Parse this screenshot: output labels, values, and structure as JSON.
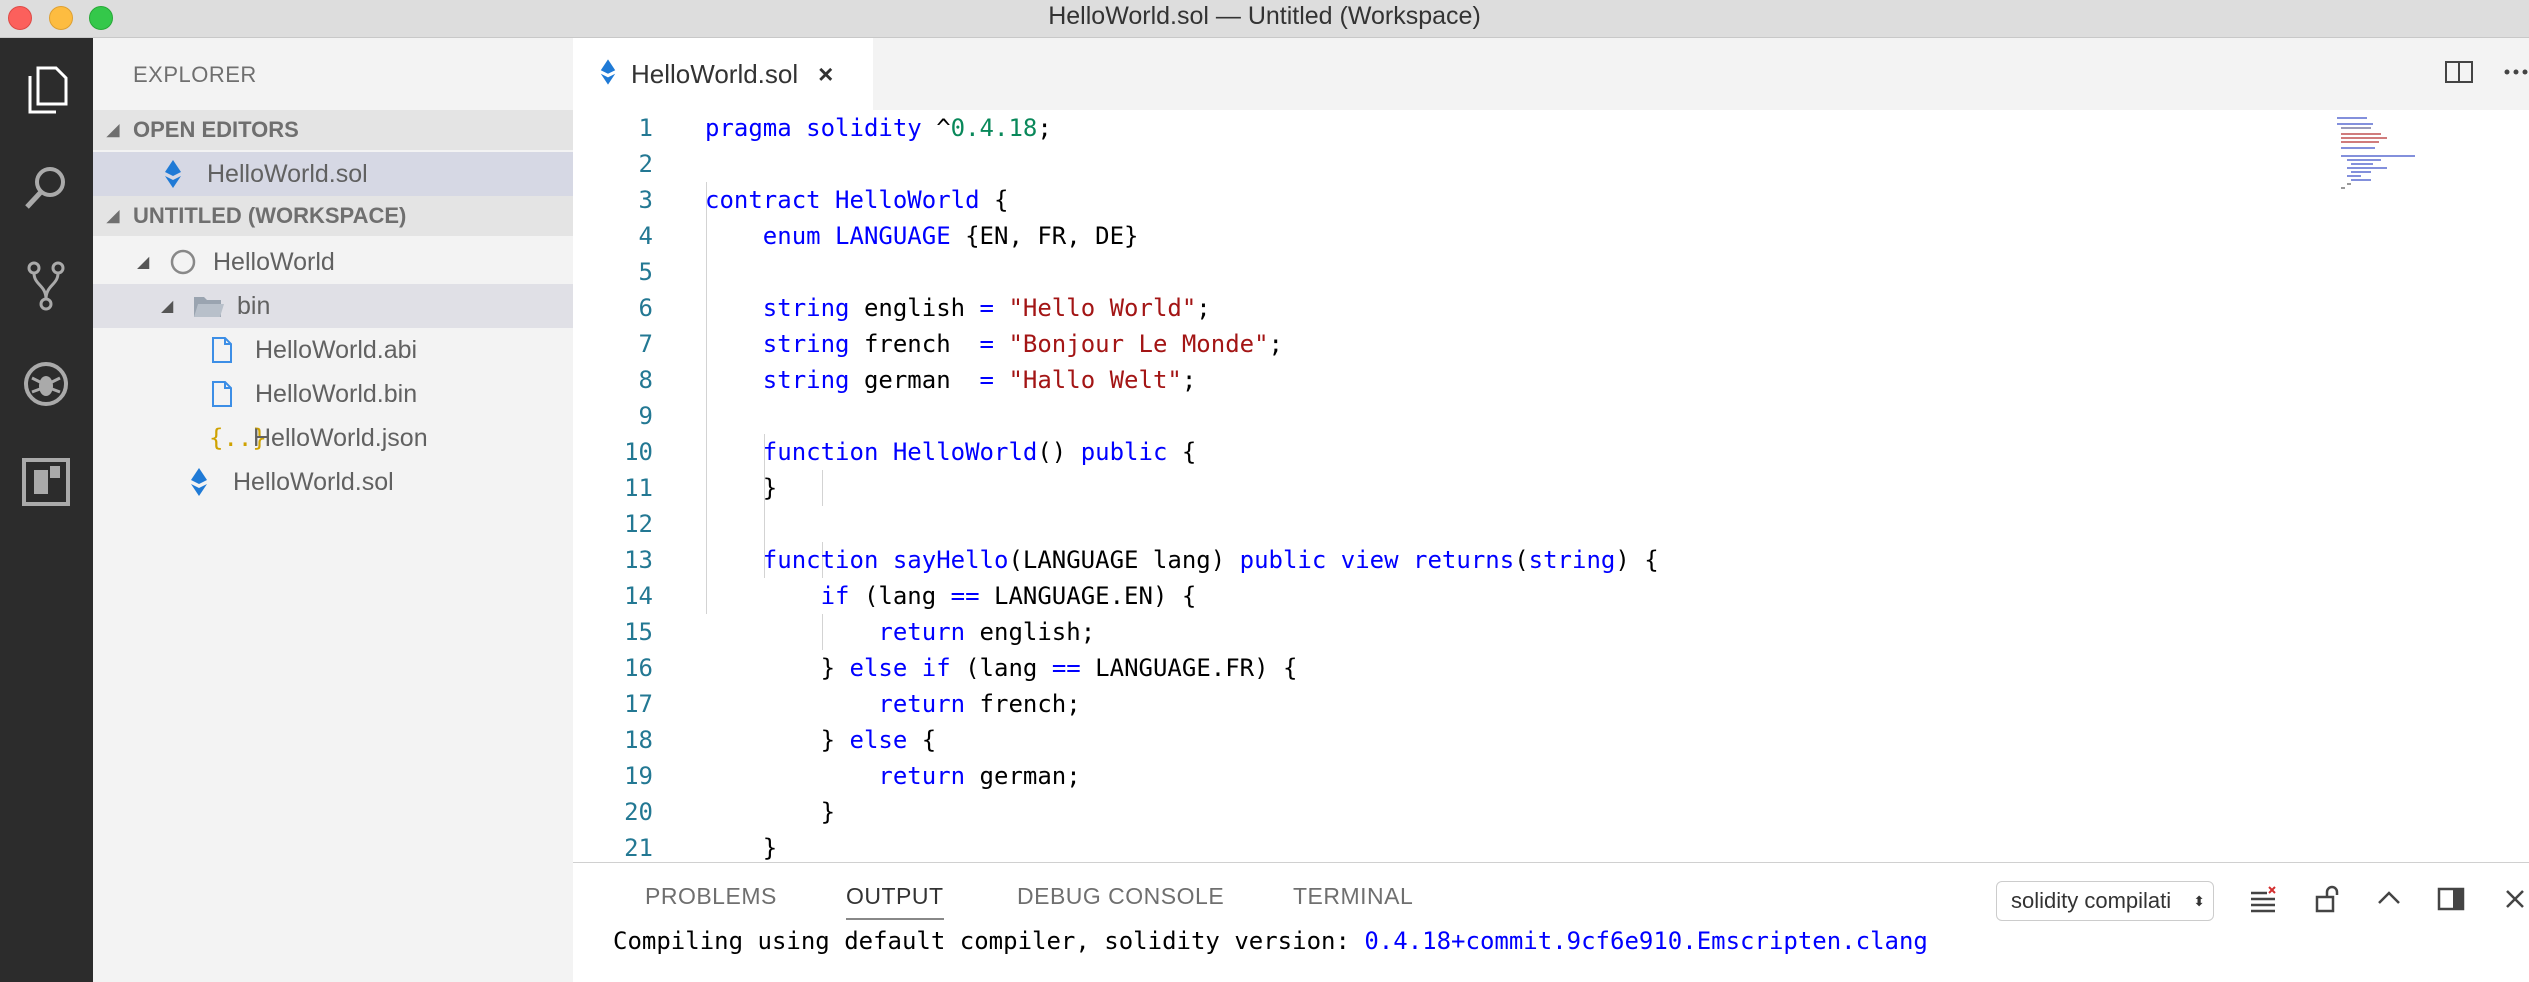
{
  "window": {
    "title": "HelloWorld.sol — Untitled (Workspace)"
  },
  "sidebar": {
    "title": "EXPLORER",
    "sections": {
      "open_editors": "OPEN EDITORS",
      "workspace": "UNTITLED (WORKSPACE)"
    },
    "open_editors": [
      {
        "label": "HelloWorld.sol",
        "icon": "solidity-icon"
      }
    ],
    "tree": [
      {
        "label": "HelloWorld",
        "icon": "folder-root-icon"
      },
      {
        "label": "bin",
        "icon": "folder-open-icon"
      },
      {
        "label": "HelloWorld.abi",
        "icon": "file-icon"
      },
      {
        "label": "HelloWorld.bin",
        "icon": "file-icon"
      },
      {
        "label": "HelloWorld.json",
        "icon": "json-icon"
      },
      {
        "label": "HelloWorld.sol",
        "icon": "solidity-icon"
      }
    ]
  },
  "editor": {
    "tab_label": "HelloWorld.sol",
    "tab_close": "×",
    "line_numbers": [
      "1",
      "2",
      "3",
      "4",
      "5",
      "6",
      "7",
      "8",
      "9",
      "10",
      "11",
      "12",
      "13",
      "14",
      "15",
      "16",
      "17",
      "18",
      "19",
      "20",
      "21"
    ]
  },
  "panel": {
    "tabs": [
      "PROBLEMS",
      "OUTPUT",
      "DEBUG CONSOLE",
      "TERMINAL"
    ],
    "active_tab": "OUTPUT",
    "channel": "solidity compilati",
    "output_prefix": "Compiling using default compiler, solidity version: ",
    "output_version": "0.4.18+commit.9cf6e910.Emscripten.clang"
  },
  "colors": {
    "keyword": "#0000ff",
    "string": "#a31515",
    "number": "#09885a",
    "line_number": "#237893",
    "activity_bar": "#2c2c2c",
    "sidebar": "#f3f3f3",
    "solidity_icon": "#1f7ad6"
  }
}
